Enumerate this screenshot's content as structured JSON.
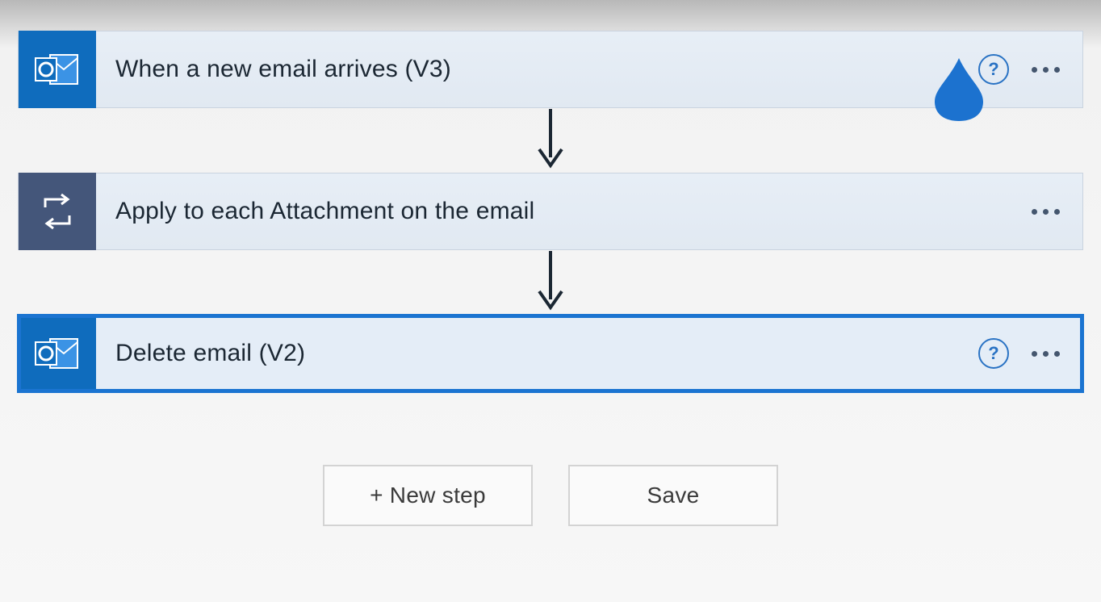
{
  "flow": {
    "steps": [
      {
        "title": "When a new email arrives (V3)",
        "icon": "outlook",
        "show_help": true,
        "selected": false
      },
      {
        "title": "Apply to each Attachment on the email",
        "icon": "loop",
        "show_help": false,
        "selected": false
      },
      {
        "title": "Delete email (V2)",
        "icon": "outlook",
        "show_help": true,
        "selected": true
      }
    ]
  },
  "buttons": {
    "new_step": "+ New step",
    "save": "Save"
  },
  "help_symbol": "?"
}
